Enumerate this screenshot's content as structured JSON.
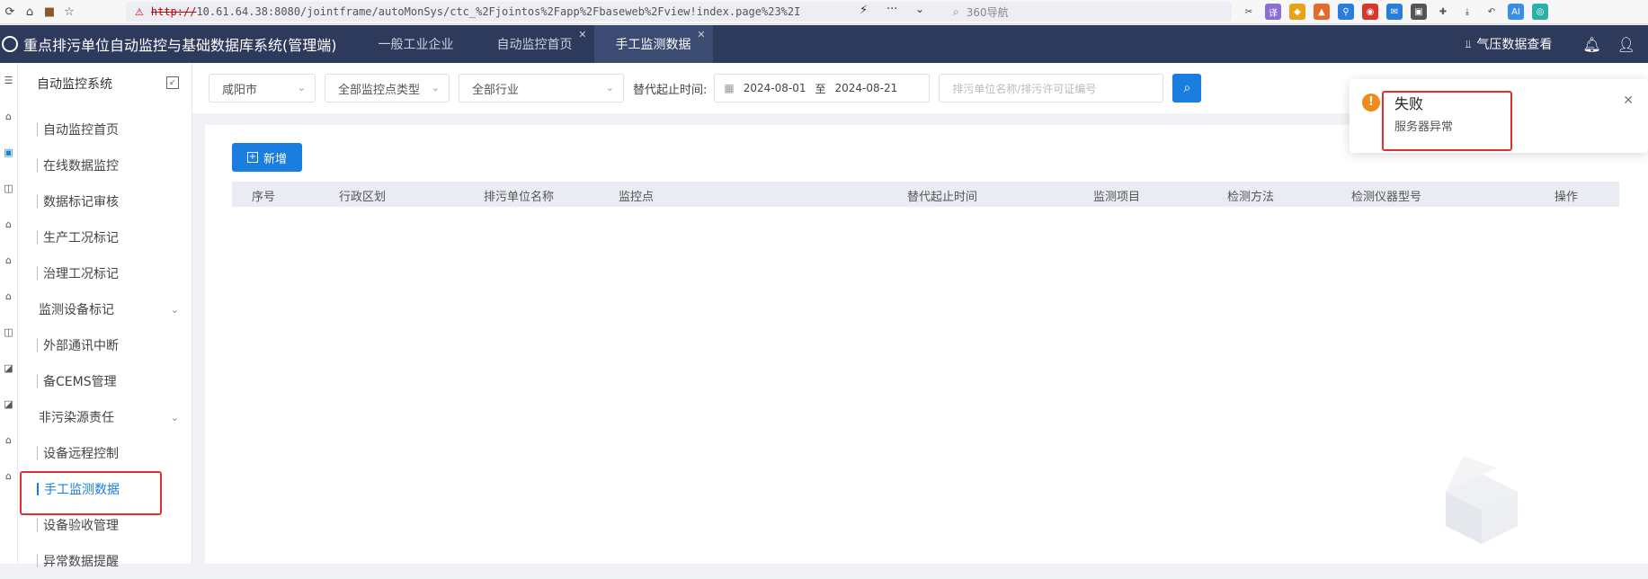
{
  "browser": {
    "url_proto": "http://",
    "url_rest": "10.61.64.38:8080/jointframe/autoMonSys/ctc_%2Fjointos%2Fapp%2Fbaseweb%2Fview!index.page%23%2I",
    "search_text": "360导航"
  },
  "header": {
    "title": "重点排污单位自动监控与基础数据库系统(管理端)",
    "tabs": [
      {
        "label": "一般工业企业"
      },
      {
        "label": "自动监控首页"
      },
      {
        "label": "手工监测数据"
      }
    ],
    "pressure_label": "气压数据查看"
  },
  "sidebar": {
    "title": "自动监控系统",
    "items": [
      {
        "label": "自动监控首页"
      },
      {
        "label": "在线数据监控"
      },
      {
        "label": "数据标记审核"
      },
      {
        "label": "生产工况标记"
      },
      {
        "label": "治理工况标记"
      },
      {
        "label": "监测设备标记"
      },
      {
        "label": "外部通讯中断"
      },
      {
        "label": "备CEMS管理"
      },
      {
        "label": "非污染源责任"
      },
      {
        "label": "设备远程控制"
      },
      {
        "label": "手工监测数据"
      },
      {
        "label": "设备验收管理"
      },
      {
        "label": "异常数据提醒"
      }
    ]
  },
  "filters": {
    "city": "咸阳市",
    "point_type": "全部监控点类型",
    "industry": "全部行业",
    "time_label": "替代起止时间:",
    "date_from": "2024-08-01",
    "date_sep": "至",
    "date_to": "2024-08-21",
    "keyword_placeholder": "排污单位名称/排污许可证编号"
  },
  "main": {
    "add_label": "新增",
    "columns": [
      "序号",
      "行政区划",
      "排污单位名称",
      "监控点",
      "替代起止时间",
      "监测项目",
      "检测方法",
      "检测仪器型号",
      "操作"
    ]
  },
  "toast": {
    "title": "失败",
    "message": "服务器异常"
  },
  "colors": {
    "header_bg": "#2d3a5c",
    "accent": "#1a7de0",
    "warning": "#ee8b1a",
    "highlight": "#e03030"
  }
}
